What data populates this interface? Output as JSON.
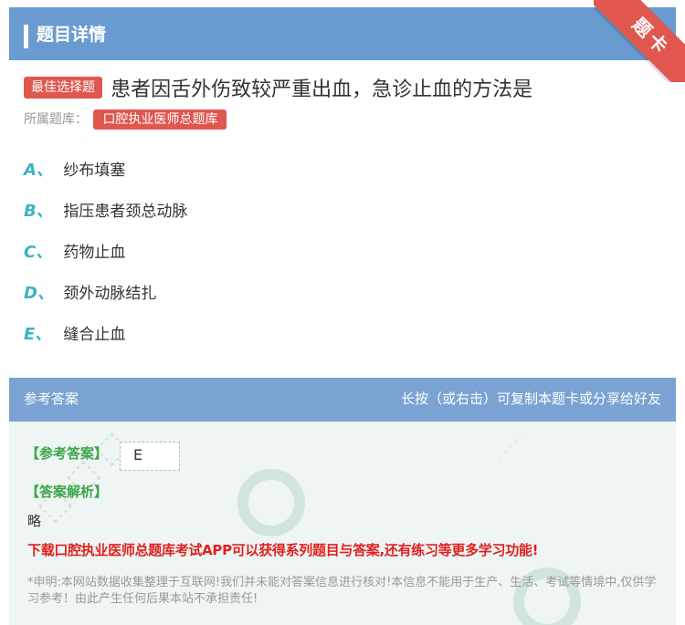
{
  "header": {
    "title": "题目详情",
    "ribbon": "题卡"
  },
  "question": {
    "type_badge": "最佳选择题",
    "text": "患者因舌外伤致较严重出血，急诊止血的方法是",
    "bank_label": "所属题库：",
    "bank_name": "口腔执业医师总题库"
  },
  "options": [
    {
      "letter": "A、",
      "text": "纱布填塞"
    },
    {
      "letter": "B、",
      "text": "指压患者颈总动脉"
    },
    {
      "letter": "C、",
      "text": "药物止血"
    },
    {
      "letter": "D、",
      "text": "颈外动脉结扎"
    },
    {
      "letter": "E、",
      "text": "缝合止血"
    }
  ],
  "answer_section": {
    "header_left": "参考答案",
    "header_right": "长按（或右击）可复制本题卡或分享给好友",
    "answer_label": "【参考答案】",
    "answer_value": "E",
    "analysis_label": "【答案解析】",
    "analysis_text": "略",
    "promo": "下载口腔执业医师总题库考试APP可以获得系列题目与答案,还有练习等更多学习功能!",
    "disclaimer": "*申明:本网站数据收集整理于互联网!我们并未能对答案信息进行核对!本信息不能用于生产、生活、考试等情境中,仅供学习参考！由此产生任何后果本站不承担责任!"
  },
  "colors": {
    "header_blue": "#6a9bd0",
    "accent_red": "#e0574f",
    "option_letter": "#3bb3c3",
    "answer_green": "#3aa64a",
    "promo_red": "#e02020"
  }
}
